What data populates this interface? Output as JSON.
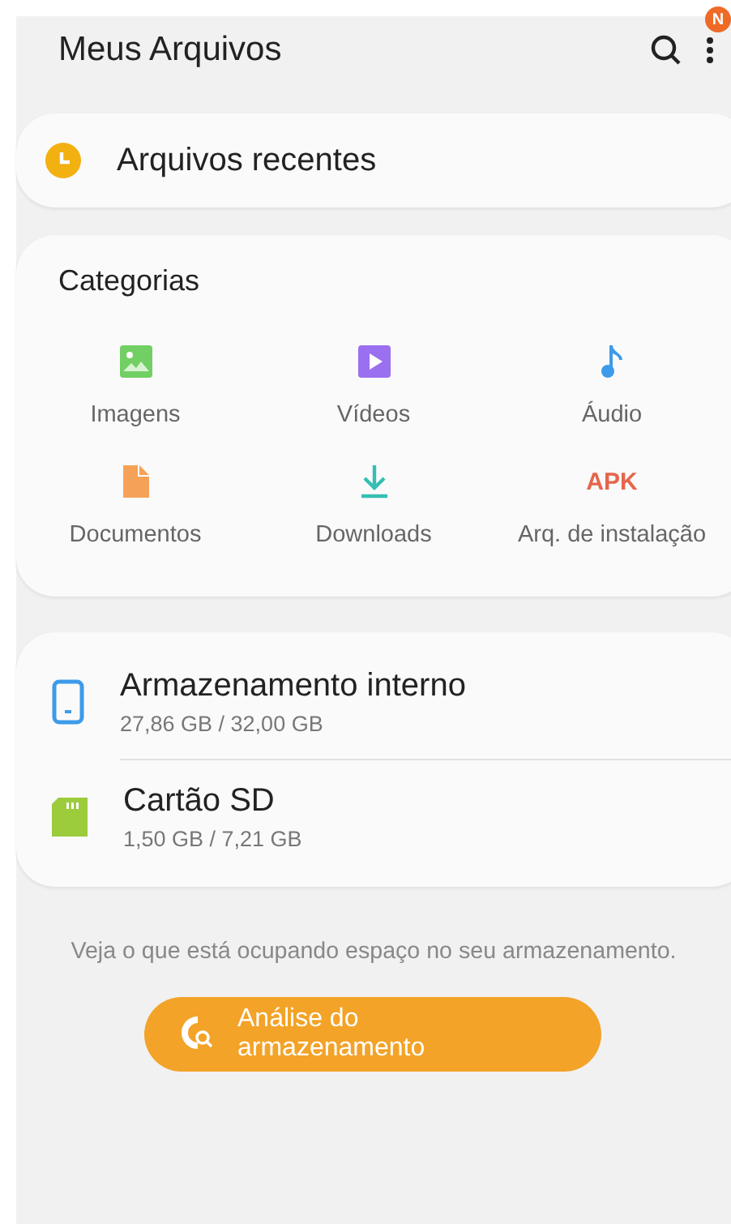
{
  "header": {
    "title": "Meus Arquivos",
    "badge": "N"
  },
  "recent": {
    "label": "Arquivos recentes"
  },
  "categories": {
    "title": "Categorias",
    "items": [
      {
        "kind": "images",
        "label": "Imagens"
      },
      {
        "kind": "videos",
        "label": "Vídeos"
      },
      {
        "kind": "audio",
        "label": "Áudio"
      },
      {
        "kind": "documents",
        "label": "Documentos"
      },
      {
        "kind": "downloads",
        "label": "Downloads"
      },
      {
        "kind": "apk",
        "label": "Arq. de instalação",
        "icon_text": "APK"
      }
    ]
  },
  "storage": [
    {
      "kind": "internal",
      "name": "Armazenamento interno",
      "usage": "27,86 GB / 32,00 GB"
    },
    {
      "kind": "sd",
      "name": "Cartão SD",
      "usage": "1,50 GB / 7,21 GB"
    }
  ],
  "hint": "Veja o que está ocupando espaço no seu armazenamento.",
  "analyze_button": {
    "label": "Análise do armazenamento"
  }
}
